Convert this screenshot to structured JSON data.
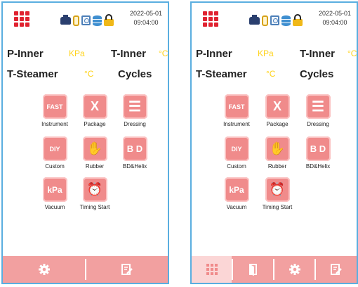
{
  "colors": {
    "accent": "#e02230",
    "tile": "#f08b8b",
    "footer": "#f2a0a0",
    "unit": "#ffd31a",
    "frame": "#5aaee0"
  },
  "panels": [
    {
      "date": "2022-05-01",
      "time": "09:04:00",
      "p_inner_label": "P-Inner",
      "p_inner_unit": "KPa",
      "t_inner_label": "T-Inner",
      "t_inner_unit": "°C",
      "t_steamer_label": "T-Steamer",
      "t_steamer_unit": "°C",
      "cycles_label": "Cycles",
      "tiles": [
        {
          "label": "Instrument",
          "glyph": "FAST"
        },
        {
          "label": "Package",
          "glyph": "X"
        },
        {
          "label": "Dressing",
          "glyph": "☰"
        },
        {
          "label": "Custom",
          "glyph": "DIY"
        },
        {
          "label": "Rubber",
          "glyph": "✋"
        },
        {
          "label": "BD&Helix",
          "glyph": "B D"
        },
        {
          "label": "Vacuum",
          "glyph": "kPa"
        },
        {
          "label": "Timing Start",
          "glyph": "⏰"
        }
      ],
      "footer_icons": [
        "gear-icon",
        "edit-icon"
      ]
    },
    {
      "date": "2022-05-01",
      "time": "09:04:00",
      "p_inner_label": "P-Inner",
      "p_inner_unit": "KPa",
      "t_inner_label": "T-Inner",
      "t_inner_unit": "°C",
      "t_steamer_label": "T-Steamer",
      "t_steamer_unit": "°C",
      "cycles_label": "Cycles",
      "tiles": [
        {
          "label": "Instrument",
          "glyph": "FAST"
        },
        {
          "label": "Package",
          "glyph": "X"
        },
        {
          "label": "Dressing",
          "glyph": "☰"
        },
        {
          "label": "Custom",
          "glyph": "DIY"
        },
        {
          "label": "Rubber",
          "glyph": "✋"
        },
        {
          "label": "BD&Helix",
          "glyph": "B D"
        },
        {
          "label": "Vacuum",
          "glyph": "kPa"
        },
        {
          "label": "Timing Start",
          "glyph": "⏰"
        }
      ],
      "footer_icons": [
        "grid-icon",
        "door-icon",
        "gear-icon",
        "edit-icon"
      ]
    }
  ]
}
